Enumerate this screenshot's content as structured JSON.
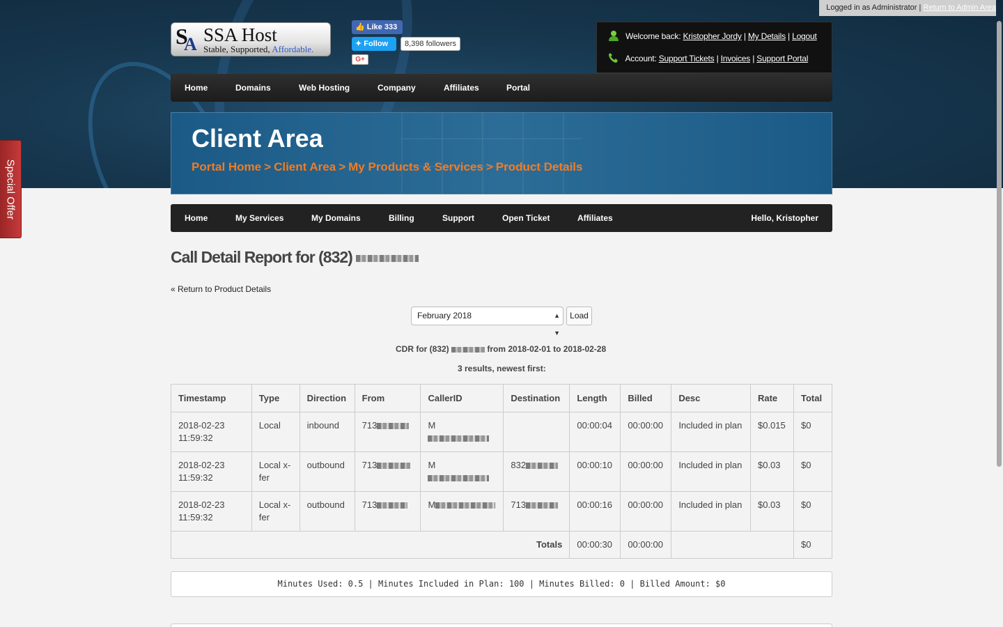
{
  "admin_bar": {
    "status": "Logged in as Administrator",
    "sep": "|",
    "return_link": "Return to Admin Area"
  },
  "special_offer": "Special Offer",
  "logo": {
    "name": "SSA Host",
    "tagline_start": "Stable, Supported,",
    "tagline_end": "Affordable."
  },
  "social": {
    "fb_like": "Like 333",
    "tw_follow": "Follow",
    "tw_followers": "8,398 followers",
    "gplus": "G+"
  },
  "account": {
    "welcome_label": "Welcome back:",
    "user_name": "Kristopher Jordy",
    "my_details": "My Details",
    "logout": "Logout",
    "account_label": "Account:",
    "support_tickets": "Support Tickets",
    "invoices": "Invoices",
    "support_portal": "Support Portal",
    "sep": "|"
  },
  "main_nav": [
    "Home",
    "Domains",
    "Web Hosting",
    "Company",
    "Affiliates",
    "Portal"
  ],
  "hero": {
    "title": "Client Area",
    "breadcrumbs": [
      "Portal Home",
      "Client Area",
      "My Products & Services",
      "Product Details"
    ],
    "separator": ">"
  },
  "sub_nav": {
    "items": [
      "Home",
      "My Services",
      "My Domains",
      "Billing",
      "Support",
      "Open Ticket",
      "Affiliates"
    ],
    "hello": "Hello, Kristopher"
  },
  "page_title": "Call Detail Report for (832)",
  "back_link": "« Return to Product Details",
  "month_select": {
    "value": "February 2018"
  },
  "load_button": "Load",
  "cdr_line": {
    "prefix": "CDR for (832)",
    "range": "from 2018-02-01 to 2018-02-28"
  },
  "results_line": "3 results, newest first:",
  "table": {
    "headers": [
      "Timestamp",
      "Type",
      "Direction",
      "From",
      "CallerID",
      "Destination",
      "Length",
      "Billed",
      "Desc",
      "Rate",
      "Total"
    ],
    "rows": [
      {
        "timestamp_date": "2018-02-23",
        "timestamp_time": "11:59:32",
        "type_a": "Local",
        "type_b": "",
        "direction": "inbound",
        "from": "713",
        "callerid": "M",
        "destination": "",
        "length": "00:00:04",
        "billed": "00:00:00",
        "desc": "Included in plan",
        "rate": "$0.015",
        "total": "$0"
      },
      {
        "timestamp_date": "2018-02-23",
        "timestamp_time": "11:59:32",
        "type_a": "Local x-",
        "type_b": "fer",
        "direction": "outbound",
        "from": "713",
        "callerid": "M",
        "destination": "832",
        "length": "00:00:10",
        "billed": "00:00:00",
        "desc": "Included in plan",
        "rate": "$0.03",
        "total": "$0"
      },
      {
        "timestamp_date": "2018-02-23",
        "timestamp_time": "11:59:32",
        "type_a": "Local x-",
        "type_b": "fer",
        "direction": "outbound",
        "from": "713",
        "callerid": "M",
        "destination": "713",
        "length": "00:00:16",
        "billed": "00:00:00",
        "desc": "Included in plan",
        "rate": "$0.03",
        "total": "$0"
      }
    ],
    "totals": {
      "label": "Totals",
      "length": "00:00:30",
      "billed": "00:00:00",
      "total": "$0"
    }
  },
  "summary": "Minutes Used: 0.5 | Minutes Included in Plan: 100 | Minutes Billed: 0 | Billed Amount: $0"
}
